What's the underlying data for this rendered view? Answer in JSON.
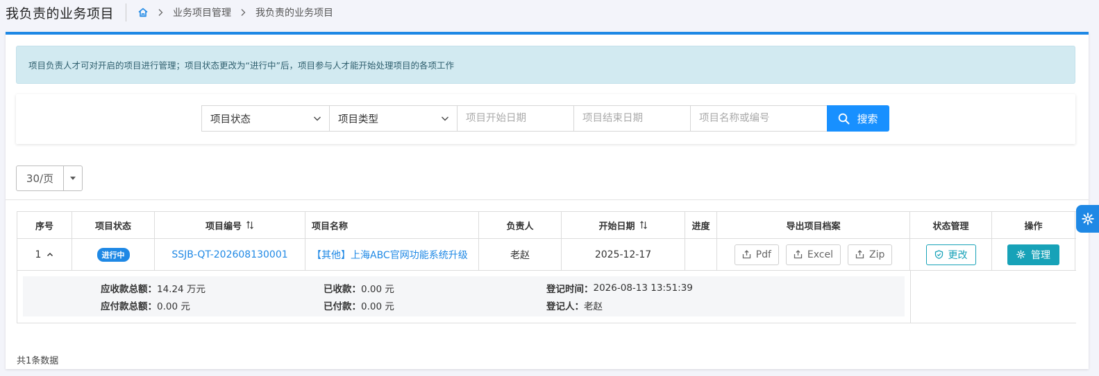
{
  "header": {
    "title": "我负责的业务项目",
    "breadcrumb": [
      "业务项目管理",
      "我负责的业务项目"
    ]
  },
  "notice": "项目负责人才可对开启的项目进行管理；项目状态更改为“进行中”后，项目参与人才能开始处理项目的各项工作",
  "search": {
    "status_select": "项目状态",
    "type_select": "项目类型",
    "start_date_placeholder": "项目开始日期",
    "end_date_placeholder": "项目结束日期",
    "keyword_placeholder": "项目名称或编号",
    "button": "搜索"
  },
  "pager": {
    "page_size": "30/页"
  },
  "table": {
    "columns": [
      "序号",
      "项目状态",
      "项目编号",
      "项目名称",
      "负责人",
      "开始日期",
      "进度",
      "导出项目档案",
      "状态管理",
      "操作"
    ],
    "rows": [
      {
        "index": "1",
        "status": "进行中",
        "code": "SSJB-QT-202608130001",
        "name": "【其他】上海ABC官网功能系统升级",
        "owner": "老赵",
        "start_date": "2025-12-17",
        "progress": "",
        "export": [
          "Pdf",
          "Excel",
          "Zip"
        ],
        "state_action": "更改",
        "operation": "管理",
        "detail": {
          "receivable_label": "应收款总额：",
          "receivable_value": "14.24 万元",
          "payable_label": "应付款总额：",
          "payable_value": "0.00 元",
          "received_label": "已收款：",
          "received_value": "0.00 元",
          "paid_label": "已付款：",
          "paid_value": "0.00 元",
          "reg_time_label": "登记时间：",
          "reg_time_value": "2026-08-13 13:51:39",
          "registrar_label": "登记人：",
          "registrar_value": "老赵"
        }
      }
    ]
  },
  "footer": {
    "total": "共1条数据"
  },
  "colors": {
    "primary": "#1e88e5",
    "teal": "#17a2b8",
    "notice_bg": "#d2eaf1"
  }
}
